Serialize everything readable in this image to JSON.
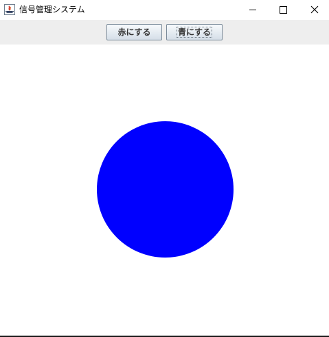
{
  "window": {
    "title": "信号管理システム",
    "app_icon": "java-icon",
    "controls": {
      "minimize_icon": "minimize-icon",
      "maximize_icon": "maximize-icon",
      "close_icon": "close-icon"
    }
  },
  "toolbar": {
    "red_button_label": "赤にする",
    "blue_button_label": "青にする",
    "focused_button": "blue"
  },
  "signal": {
    "shape": "circle",
    "color": "#0000ff"
  },
  "colors": {
    "toolbar_bg": "#eeeeee",
    "canvas_bg": "#ffffff"
  }
}
